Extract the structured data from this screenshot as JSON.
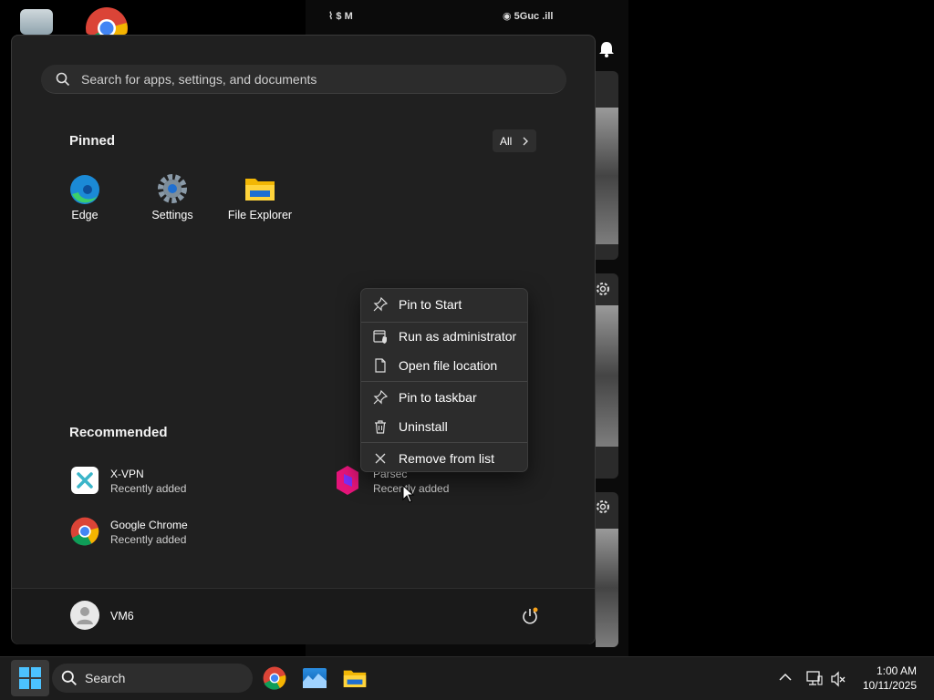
{
  "phone": {
    "status_left": "⌇ $ M",
    "status_right": "◉ 5Guc .ill"
  },
  "start_menu": {
    "search_placeholder": "Search for apps, settings, and documents",
    "pinned_title": "Pinned",
    "all_button": "All",
    "pinned_apps": [
      {
        "label": "Edge",
        "icon": "edge-icon"
      },
      {
        "label": "Settings",
        "icon": "settings-gear-icon"
      },
      {
        "label": "File Explorer",
        "icon": "folder-icon"
      }
    ],
    "recommended_title": "Recommended",
    "recommended": [
      {
        "title": "X-VPN",
        "subtitle": "Recently added"
      },
      {
        "title": "Parsec",
        "subtitle": "Recently added"
      },
      {
        "title": "Google Chrome",
        "subtitle": "Recently added"
      }
    ],
    "user_name": "VM6"
  },
  "context_menu": {
    "items": [
      {
        "label": "Pin to Start",
        "icon": "pin-icon"
      },
      {
        "label": "Run as administrator",
        "icon": "shield-window-icon"
      },
      {
        "label": "Open file location",
        "icon": "file-location-icon"
      },
      {
        "label": "Pin to taskbar",
        "icon": "pin-icon"
      },
      {
        "label": "Uninstall",
        "icon": "trash-icon"
      },
      {
        "label": "Remove from list",
        "icon": "close-icon"
      }
    ]
  },
  "taskbar": {
    "search_label": "Search",
    "time": "1:00 AM",
    "date": "10/11/2025"
  },
  "colors": {
    "start_bg": "#202020",
    "menu_bg": "#2c2c2c",
    "accent": "#0078d4"
  }
}
